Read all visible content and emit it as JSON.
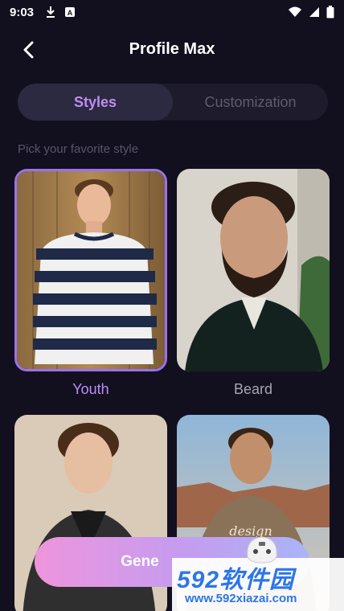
{
  "status_bar": {
    "time": "9:03"
  },
  "header": {
    "title": "Profile Max"
  },
  "tabs": [
    {
      "label": "Styles",
      "active": true
    },
    {
      "label": "Customization",
      "active": false
    }
  ],
  "hint": "Pick your favorite style",
  "styles": [
    {
      "label": "Youth",
      "selected": true
    },
    {
      "label": "Beard",
      "selected": false
    },
    {
      "label": "",
      "selected": false
    },
    {
      "label": "",
      "selected": false
    }
  ],
  "generate_button": {
    "label": "Gene"
  },
  "watermark": {
    "main": "592软件园",
    "url": "www.592xiazai.com"
  },
  "colors": {
    "accent": "#c08cf5",
    "background": "#12101f",
    "selected_border": "#9a72ea"
  }
}
